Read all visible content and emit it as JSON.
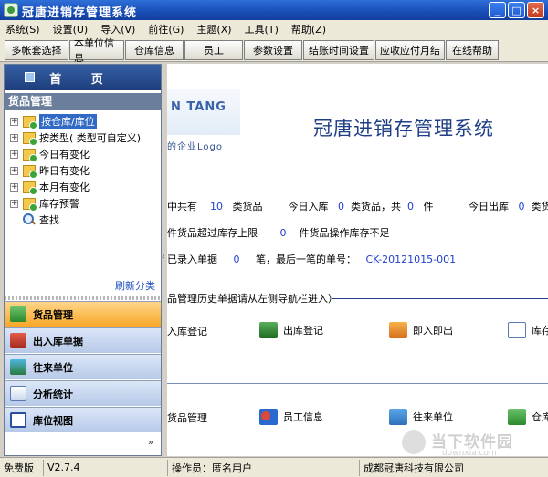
{
  "window": {
    "title": "冠唐进销存管理系统",
    "min": "_",
    "max": "□",
    "close": "×"
  },
  "menu": [
    "系统(S)",
    "设置(U)",
    "导入(V)",
    "前往(G)",
    "主题(X)",
    "工具(T)",
    "帮助(Z)"
  ],
  "toolbar": [
    "多帐套选择",
    "本单位信息",
    "仓库信息",
    "员工",
    "参数设置",
    "结账时间设置",
    "应收应付月结",
    "在线帮助"
  ],
  "left": {
    "home": "首 页",
    "panel_title": "货品管理",
    "tree": [
      {
        "label": "按仓库/库位",
        "icon": "folder-icon",
        "expander": "+"
      },
      {
        "label": "按类型( 类型可自定义)",
        "icon": "folder-icon",
        "expander": "+"
      },
      {
        "label": "今日有变化",
        "icon": "folder-icon",
        "expander": "+"
      },
      {
        "label": "昨日有变化",
        "icon": "folder-icon",
        "expander": "+"
      },
      {
        "label": "本月有变化",
        "icon": "folder-icon",
        "expander": "+"
      },
      {
        "label": "库存预警",
        "icon": "folder-icon",
        "expander": "+"
      },
      {
        "label": "查找",
        "icon": "search-icon",
        "expander": ""
      }
    ],
    "refresh": "刷新分类",
    "nav": [
      "货品管理",
      "出入库单据",
      "往来单位",
      "分析统计",
      "库位视图"
    ],
    "more": "»"
  },
  "main": {
    "logo_text": "N TANG",
    "logo_sub": "的企业Logo",
    "title": "冠唐进销存管理系统",
    "stats": {
      "line1": {
        "a": "中共有",
        "b": "10",
        "c": "类货品",
        "d": "今日入库",
        "e": "0",
        "f": "类货品，共",
        "g": "0",
        "h": "件",
        "i": "今日出库",
        "j": "0",
        "k": "类货品"
      },
      "line2": {
        "a": "件货品超过库存上限",
        "b": "0",
        "c": "件货品操作库存不足"
      },
      "line3": {
        "a": "已录入单据",
        "b": "0",
        "c": "笔，最后一笔的单号：",
        "d": "CK-20121015-001"
      }
    },
    "section": "品管理历史单据请从左侧导航栏进入）",
    "actions1": [
      "入库登记",
      "出库登记",
      "即入即出",
      "库存"
    ],
    "actions2": [
      "货品管理",
      "员工信息",
      "往来单位",
      "仓库"
    ]
  },
  "watermark": {
    "name": "当下软件园",
    "url": "downxia.com"
  },
  "status": {
    "edition": "免费版",
    "version": "V2.7.4",
    "operator": "操作员：匿名用户",
    "company": "成都冠唐科技有限公司"
  },
  "colors": {
    "titlebar": "#1a4fb8",
    "accent": "#316ac5",
    "nav_active": "#f7a727"
  }
}
